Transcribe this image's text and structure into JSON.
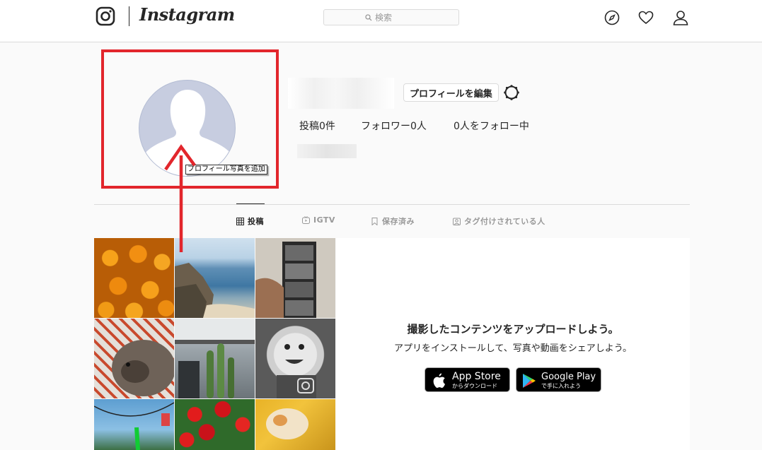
{
  "header": {
    "wordmark": "Instagram",
    "search_placeholder": "検索"
  },
  "profile": {
    "edit_button": "プロフィールを編集",
    "stats": {
      "posts": "投稿0件",
      "followers": "フォロワー0人",
      "following": "0人をフォロー中"
    },
    "avatar_tooltip": "プロフィール写真を追加"
  },
  "tabs": [
    {
      "label": "投稿",
      "icon": "grid-icon"
    },
    {
      "label": "IGTV",
      "icon": "igtv-icon"
    },
    {
      "label": "保存済み",
      "icon": "bookmark-icon"
    },
    {
      "label": "タグ付けされている人",
      "icon": "tagged-icon"
    }
  ],
  "promo": {
    "title": "撮影したコンテンツをアップロードしよう。",
    "subtitle": "アプリをインストールして、写真や動画をシェアしよう。",
    "app_store": {
      "big": "App Store",
      "small": "からダウンロード"
    },
    "google_play": {
      "big": "Google Play",
      "small": "で手に入れよう"
    }
  },
  "colors": {
    "annotation_red": "#e2262c",
    "border": "#dbdbdb",
    "text": "#262626"
  }
}
